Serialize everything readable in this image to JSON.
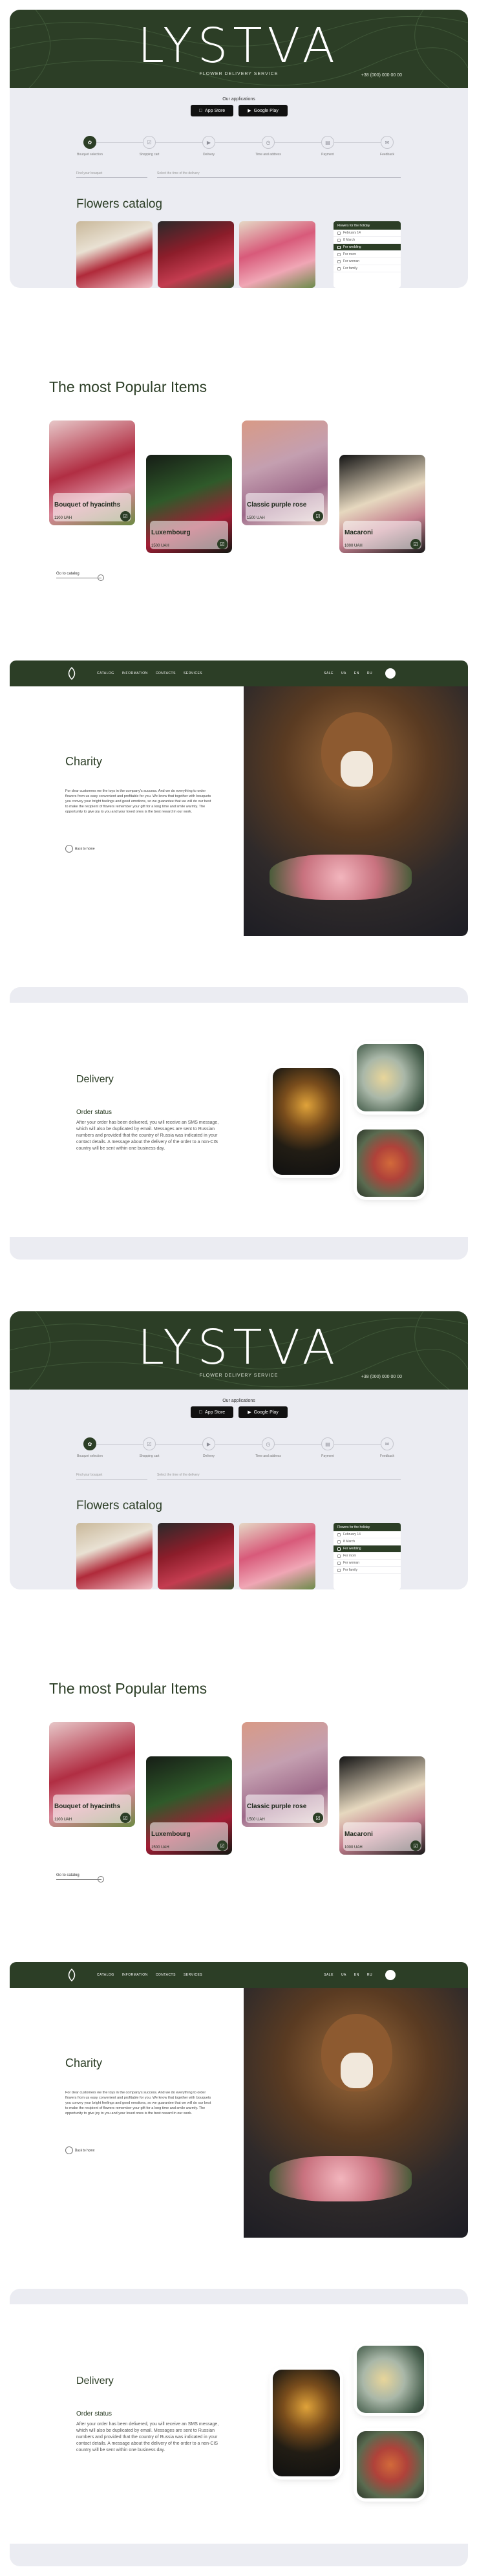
{
  "brand": {
    "logo": "LYSTVA",
    "tagline": "FLOWER DELIVERY SERVICE",
    "phone": "+38 (000) 000 00 00"
  },
  "apps": {
    "title": "Our applications",
    "app_store": "App Store",
    "google_play": "Google Play"
  },
  "steps": [
    {
      "label": "Bouquet selection",
      "icon": "flower-icon"
    },
    {
      "label": "Shopping cart",
      "icon": "cart-icon"
    },
    {
      "label": "Delivery",
      "icon": "truck-icon"
    },
    {
      "label": "Time and address",
      "icon": "clock-icon"
    },
    {
      "label": "Payment",
      "icon": "card-icon"
    },
    {
      "label": "Feedback",
      "icon": "chat-icon"
    }
  ],
  "search": {
    "first_placeholder": "Find your bouquet",
    "second_placeholder": "Select the time of the delivery"
  },
  "catalog": {
    "title": "Flowers catalog",
    "holiday_title": "Flowers for the holiday",
    "holidays": [
      {
        "label": "February 14",
        "selected": false
      },
      {
        "label": "8 March",
        "selected": false
      },
      {
        "label": "For wedding",
        "selected": true
      },
      {
        "label": "For mom",
        "selected": false
      },
      {
        "label": "For woman",
        "selected": false
      },
      {
        "label": "For family",
        "selected": false
      }
    ]
  },
  "popular": {
    "title": "The most Popular Items",
    "items": [
      {
        "name": "Bouquet of hyacinths",
        "price": "1100 UAH",
        "colors": [
          "#8b3a45",
          "#d7a7b3",
          "#5e7f3d"
        ]
      },
      {
        "name": "Luxembourg",
        "price": "1500 UAH",
        "colors": [
          "#19211a",
          "#3e6a38",
          "#b3263d"
        ]
      },
      {
        "name": "Classic purple rose",
        "price": "1500 UAH",
        "colors": [
          "#c9a0a8",
          "#9e6a8a",
          "#f0d0c8"
        ]
      },
      {
        "name": "Macaroni",
        "price": "1000 UAH",
        "colors": [
          "#1a1a1a",
          "#e9dcc3",
          "#c97e8c"
        ]
      }
    ],
    "goto": "Go to catalog"
  },
  "nav": {
    "items": [
      "CATALOG",
      "INFORMATION",
      "CONTACTS",
      "SERVICES"
    ],
    "right": [
      "SALE",
      "UA",
      "EN",
      "RU"
    ],
    "logo_mark": "LYSTVA"
  },
  "charity": {
    "title": "Charity",
    "text": "For dear customers we the toys in the company's success. And we do everything to order flowers from us easy convenient and profitable for you. We know that together with bouquets you convey your bright feelings and good emotions, so we guarantee that we will do our best to make the recipient of flowers remember your gift for a long time and smile warmly. The opportunity to give joy to you and your loved ones is the best reward in our work.",
    "back": "Back to home"
  },
  "delivery": {
    "title": "Delivery",
    "subtitle": "Order status",
    "text": "After your order has been delivered, you will receive an SMS message, which will also be duplicated by email. Messages are sent to Russian numbers and provided that the country of Russia was indicated in your contact details. A message about the delivery of the order to a non-CIS country will be sent within one business day."
  },
  "colors": {
    "brand_green": "#2c3e26",
    "panel": "#ebecf2",
    "white": "#ffffff"
  }
}
